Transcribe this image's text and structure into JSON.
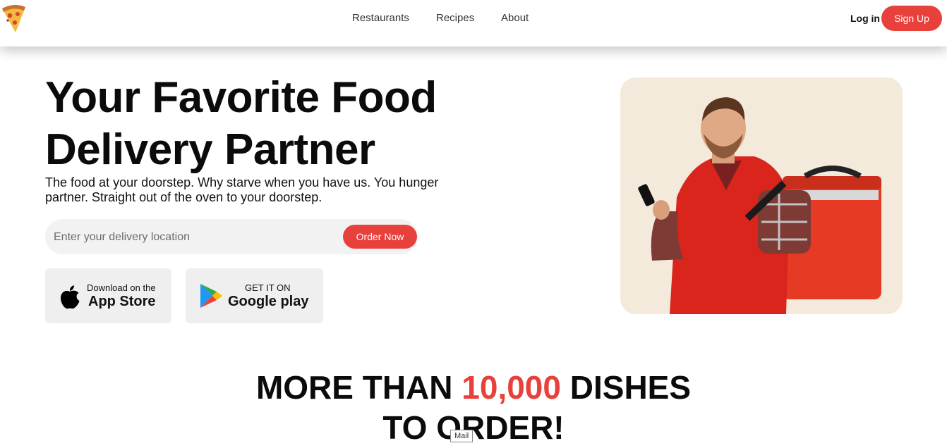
{
  "header": {
    "logo_icon": "pizza-slice-icon",
    "nav": {
      "restaurants": "Restaurants",
      "recipes": "Recipes",
      "about": "About"
    },
    "login_label": "Log in",
    "signup_label": "Sign Up"
  },
  "hero": {
    "title_line1": "Your Favorite Food",
    "title_line2": "Delivery Partner",
    "subtitle": "The food at your doorstep. Why starve when you have us. You hunger partner. Straight out of the oven to your doorstep.",
    "search": {
      "placeholder": "Enter your delivery location",
      "value": "",
      "button_label": "Order Now"
    },
    "app_store": {
      "icon": "apple-icon",
      "small": "Download on the",
      "big": "App Store"
    },
    "google_play": {
      "icon": "google-play-icon",
      "small": "GET IT ON",
      "big": "Google play"
    },
    "image": "delivery-man-with-red-backpack-photo"
  },
  "dishes": {
    "prefix": "MORE THAN",
    "highlight": "10,000",
    "suffix": "DISHES",
    "line2": "TO ORDER!"
  },
  "tooltip": "Mail",
  "colors": {
    "accent": "#e8403b",
    "card_bg": "#f4eadc",
    "search_bg": "#f2f2f2",
    "store_bg": "#efefef"
  }
}
